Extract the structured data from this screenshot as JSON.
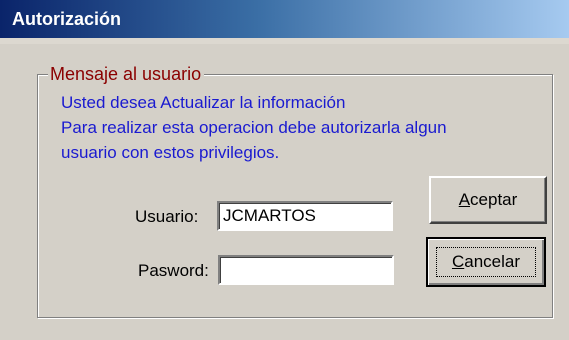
{
  "window": {
    "title": "Autorización"
  },
  "group": {
    "legend": "Mensaje al usuario",
    "message_lines": [
      "Usted desea Actualizar la información",
      "Para realizar esta operacion debe autorizarla algun",
      "usuario con estos privilegios."
    ]
  },
  "form": {
    "usuario_label": "Usuario:",
    "usuario_value": "JCMARTOS",
    "password_label": "Pasword:",
    "password_value": ""
  },
  "buttons": {
    "aceptar": {
      "mnemonic": "A",
      "rest": "ceptar"
    },
    "cancelar": {
      "mnemonic": "C",
      "rest": "ancelar"
    }
  },
  "colors": {
    "title_start": "#0a246a",
    "title_end": "#a6caf0",
    "legend_text": "#8b0000",
    "message_text": "#1a1ad0",
    "face": "#d4d0c8"
  }
}
